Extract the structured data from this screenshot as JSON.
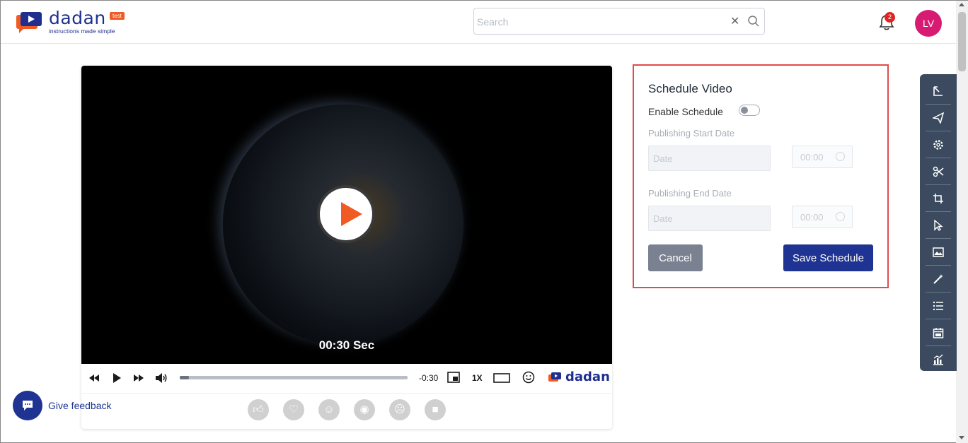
{
  "header": {
    "logo_word": "dadan",
    "logo_tagline": "instructions made simple",
    "logo_badge": "test",
    "search_placeholder": "Search",
    "notification_count": "2",
    "avatar_initials": "LV"
  },
  "player": {
    "duration_overlay": "00:30 Sec",
    "time_remaining": "-0:30",
    "speed": "1X",
    "brand": "dadan",
    "progress_percent": 4
  },
  "schedule": {
    "title": "Schedule Video",
    "enable_label": "Enable Schedule",
    "start_label": "Publishing Start Date",
    "end_label": "Publishing End Date",
    "date_placeholder": "Date",
    "time_placeholder": "00:00",
    "cancel_label": "Cancel",
    "save_label": "Save Schedule"
  },
  "feedback": {
    "label": "Give feedback"
  },
  "colors": {
    "brand_blue": "#1f3393",
    "accent_orange": "#f05a24",
    "highlight_red": "#e04b4b"
  }
}
